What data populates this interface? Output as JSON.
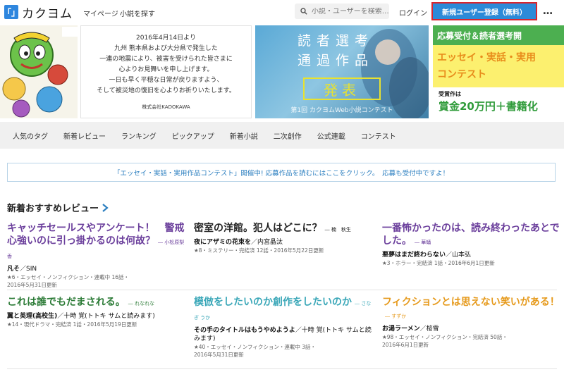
{
  "header": {
    "logo_mark": "「」",
    "logo_text": "カクヨム",
    "nav_mypage": "マイページ",
    "nav_search_novel": "小説を探す",
    "search_placeholder": "小説・ユーザーを検索…",
    "login": "ログイン",
    "signup": "新規ユーザー登録（無料）",
    "more": "…"
  },
  "banners": {
    "notice_lines": [
      "2016年4月14日より",
      "九州 熊本県および大分県で発生した",
      "一連の地震により、被害を受けられた皆さまに",
      "心よりお見舞いを申し上げます。",
      "一日も早く平穏な日常が戻りますよう、",
      "そして被災地の復旧を心よりお祈りいたします。"
    ],
    "notice_company": "株式会社KADOKAWA",
    "contest_title_1": "読者選考",
    "contest_title_2": "通過作品",
    "contest_happyo": "発表",
    "contest_sub": "第1回 カクヨムWeb小説コンテスト",
    "essay_top": "応募受付＆読者選考開",
    "essay_mid_1": "エッセイ・実話・実用",
    "essay_mid_2": "コンテスト",
    "essay_prize_label": "受賞作は",
    "essay_prize": "賞金20万円＋書籍化"
  },
  "tabs": [
    "人気のタグ",
    "新着レビュー",
    "ランキング",
    "ピックアップ",
    "新着小説",
    "二次創作",
    "公式連載",
    "コンテスト"
  ],
  "notice_bar": "「エッセイ・実話・実用作品コンテスト」開催中! 応募作品を読むにはここをクリック。　応募も受付中ですよ！",
  "section_title": "新着おすすめレビュー",
  "colors": {
    "purple": "#6b3f9c",
    "black": "#222222",
    "teal": "#3aa7b8",
    "orange": "#e69a1c",
    "accent_blue": "#2c8ad8",
    "alert_red": "#d8262f"
  },
  "reviews": [
    {
      "title": "キャッチセールスやアンケート！　警戒心強いのに引っ掛かるのは何故？",
      "by": "― 小松原梨香",
      "work": "凡そ",
      "author": "SIN",
      "meta_1": "★6・エッセイ・ノンフィクション・連載中 16話・",
      "meta_2": "2016年5月31日更新",
      "color": "#6b3f9c"
    },
    {
      "title": "密室の洋館。犯人はどこに？",
      "by": "― 楠　秋生",
      "work": "夜にアザミの花束を",
      "author": "内宮晶汰",
      "meta_1": "★8・ミステリー・完結済 12話・2016年5月22日更新",
      "meta_2": "",
      "color": "#222222"
    },
    {
      "title": "一番怖かったのは、読み終わったあとでした。",
      "by": "― 華蛹",
      "work": "悪夢はまだ終わらない",
      "author": "山本弘",
      "meta_1": "★3・ホラー・完結済 1話・2016年6月1日更新",
      "meta_2": "",
      "color": "#6b3f9c"
    },
    {
      "title": "これは誰でもだまされる。",
      "by": "― れなれな",
      "work": "翼と英理(高校生)",
      "author": "十時 覚(トトキ サムと読みます)",
      "meta_1": "★14・現代ドラマ・完結済 1話・2016年5月19日更新",
      "meta_2": "",
      "color": "#2a7a35"
    },
    {
      "title": "模倣をしたいのか創作をしたいのか",
      "by": "― さなぎ うか",
      "work": "その手のタイトルはもうやめようよ",
      "author": "十時 覚(トトキ サムと読みます)",
      "meta_1": "★40・エッセイ・ノンフィクション・連載中 3話・",
      "meta_2": "2016年5月31日更新",
      "color": "#3aa7b8"
    },
    {
      "title": "フィクションとは思えない笑いがある！",
      "by": "― すずか",
      "work": "お湯ラーメン",
      "author": "桜雪",
      "meta_1": "★98・エッセイ・ノンフィクション・完結済 50話・",
      "meta_2": "2016年6月1日更新",
      "color": "#e69a1c"
    }
  ]
}
